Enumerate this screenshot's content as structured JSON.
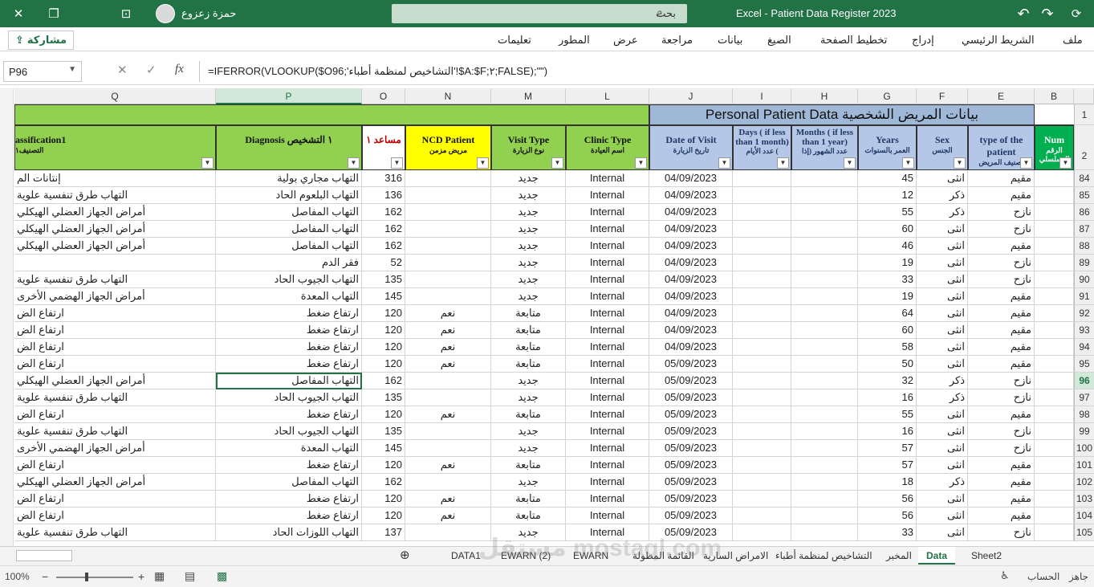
{
  "titlebar": {
    "app_title": "Excel  -  Patient Data Register   2023",
    "search_placeholder": "بحث",
    "user_name": "حمزة زعزوع",
    "close_glyph": "✕",
    "restore_glyph": "❐",
    "ribbon_glyph": "⊡",
    "undo_glyph": "↶",
    "redo_glyph": "↷",
    "save_glyph": "⟳"
  },
  "ribbon": {
    "share_label": "مشاركة",
    "tabs": [
      "ملف",
      "الشريط الرئيسي",
      "إدراج",
      "تخطيط الصفحة",
      "الصيغ",
      "بيانات",
      "مراجعة",
      "عرض",
      "المطور",
      "تعليمات"
    ]
  },
  "formula_bar": {
    "name_box": "P96",
    "formula": "=IFERROR(VLOOKUP($O96;'التشاخيص لمنظمة أطباء'!$A:$F;٢;FALSE);\"\")",
    "cancel": "✕",
    "enter": "✓",
    "fx": "fx"
  },
  "columns": [
    "Q",
    "P",
    "O",
    "N",
    "M",
    "L",
    "J",
    "I",
    "H",
    "G",
    "F",
    "E",
    "B"
  ],
  "group_header": "بيانات المريض الشخصية  Personal Patient Data",
  "headers": {
    "classification": "assification1",
    "classification_ar": "التصنيف١",
    "diagnosis": "Diagnosis ١ التشخيص",
    "assistant": "مساعد ١",
    "ncd": "NCD Patient",
    "ncd_ar": "مريض مزمن",
    "visit_type": "Visit Type",
    "visit_type_ar": "نوع الزيارة",
    "clinic": "Clinic Type",
    "clinic_ar": "اسم العيادة",
    "date": "Date of Visit",
    "date_ar": "تاريخ الزيارة",
    "days": "Days ( if less than 1 month)",
    "days_ar": "عدد الأيام (",
    "months": "Months ( if less than 1 year)",
    "months_ar": "عدد الشهور (إذا",
    "years": "Years",
    "years_ar": "العمر بالسنوات",
    "sex": "Sex",
    "sex_ar": "الجنس",
    "type": "type of the patient",
    "type_ar": "تصنيف المريض",
    "num": "Num",
    "num_ar": "الرقم التسلسلي"
  },
  "rows": [
    {
      "n": "84",
      "q": "إنتانات الم",
      "p": "التهاب مجاري بولية",
      "o": "316",
      "ncd": "",
      "m": "جديد",
      "l": "Internal",
      "j": "04/09/2023",
      "g": "45",
      "f": "انثى",
      "e": "مقيم"
    },
    {
      "n": "85",
      "q": "التهاب طرق تنفسية علوية",
      "p": "التهاب البلعوم الحاد",
      "o": "136",
      "ncd": "",
      "m": "جديد",
      "l": "Internal",
      "j": "04/09/2023",
      "g": "12",
      "f": "ذكر",
      "e": "مقيم"
    },
    {
      "n": "86",
      "q": "أمراض الجهاز العضلي الهيكلي",
      "p": "التهاب المفاصل",
      "o": "162",
      "ncd": "",
      "m": "جديد",
      "l": "Internal",
      "j": "04/09/2023",
      "g": "55",
      "f": "ذكر",
      "e": "نازح"
    },
    {
      "n": "87",
      "q": "أمراض الجهاز العضلي الهيكلي",
      "p": "التهاب المفاصل",
      "o": "162",
      "ncd": "",
      "m": "جديد",
      "l": "Internal",
      "j": "04/09/2023",
      "g": "60",
      "f": "انثى",
      "e": "نازح"
    },
    {
      "n": "88",
      "q": "أمراض الجهاز العضلي الهيكلي",
      "p": "التهاب المفاصل",
      "o": "162",
      "ncd": "",
      "m": "جديد",
      "l": "Internal",
      "j": "04/09/2023",
      "g": "46",
      "f": "انثى",
      "e": "مقيم"
    },
    {
      "n": "89",
      "q": "",
      "p": "فقر الدم",
      "o": "52",
      "ncd": "",
      "m": "جديد",
      "l": "Internal",
      "j": "04/09/2023",
      "g": "19",
      "f": "انثى",
      "e": "نازح"
    },
    {
      "n": "90",
      "q": "التهاب طرق تنفسية علوية",
      "p": "التهاب الجيوب الحاد",
      "o": "135",
      "ncd": "",
      "m": "جديد",
      "l": "Internal",
      "j": "04/09/2023",
      "g": "33",
      "f": "انثى",
      "e": "نازح"
    },
    {
      "n": "91",
      "q": "أمراض الجهاز الهضمي الأخرى",
      "p": "التهاب المعدة",
      "o": "145",
      "ncd": "",
      "m": "جديد",
      "l": "Internal",
      "j": "04/09/2023",
      "g": "19",
      "f": "انثى",
      "e": "مقيم"
    },
    {
      "n": "92",
      "q": "ارتفاع الض",
      "p": "ارتفاع ضغط",
      "o": "120",
      "ncd": "نعم",
      "m": "متابعة",
      "l": "Internal",
      "j": "04/09/2023",
      "g": "64",
      "f": "انثى",
      "e": "مقيم"
    },
    {
      "n": "93",
      "q": "ارتفاع الض",
      "p": "ارتفاع ضغط",
      "o": "120",
      "ncd": "نعم",
      "m": "متابعة",
      "l": "Internal",
      "j": "04/09/2023",
      "g": "60",
      "f": "انثى",
      "e": "مقيم"
    },
    {
      "n": "94",
      "q": "ارتفاع الض",
      "p": "ارتفاع ضغط",
      "o": "120",
      "ncd": "نعم",
      "m": "متابعة",
      "l": "Internal",
      "j": "04/09/2023",
      "g": "58",
      "f": "انثى",
      "e": "مقيم"
    },
    {
      "n": "95",
      "q": "ارتفاع الض",
      "p": "ارتفاع ضغط",
      "o": "120",
      "ncd": "نعم",
      "m": "متابعة",
      "l": "Internal",
      "j": "05/09/2023",
      "g": "50",
      "f": "انثى",
      "e": "مقيم"
    },
    {
      "n": "96",
      "q": "أمراض الجهاز العضلي الهيكلي",
      "p": "التهاب المفاصل",
      "o": "162",
      "ncd": "",
      "m": "جديد",
      "l": "Internal",
      "j": "05/09/2023",
      "g": "32",
      "f": "ذكر",
      "e": "نازح"
    },
    {
      "n": "97",
      "q": "التهاب طرق تنفسية علوية",
      "p": "التهاب الجيوب الحاد",
      "o": "135",
      "ncd": "",
      "m": "جديد",
      "l": "Internal",
      "j": "05/09/2023",
      "g": "16",
      "f": "ذكر",
      "e": "نازح"
    },
    {
      "n": "98",
      "q": "ارتفاع الض",
      "p": "ارتفاع ضغط",
      "o": "120",
      "ncd": "نعم",
      "m": "متابعة",
      "l": "Internal",
      "j": "05/09/2023",
      "g": "55",
      "f": "انثى",
      "e": "مقيم"
    },
    {
      "n": "99",
      "q": "التهاب طرق تنفسية علوية",
      "p": "التهاب الجيوب الحاد",
      "o": "135",
      "ncd": "",
      "m": "جديد",
      "l": "Internal",
      "j": "05/09/2023",
      "g": "16",
      "f": "انثى",
      "e": "نازح"
    },
    {
      "n": "100",
      "q": "أمراض الجهاز الهضمي الأخرى",
      "p": "التهاب المعدة",
      "o": "145",
      "ncd": "",
      "m": "جديد",
      "l": "Internal",
      "j": "05/09/2023",
      "g": "57",
      "f": "انثى",
      "e": "نازح"
    },
    {
      "n": "101",
      "q": "ارتفاع الض",
      "p": "ارتفاع ضغط",
      "o": "120",
      "ncd": "نعم",
      "m": "متابعة",
      "l": "Internal",
      "j": "05/09/2023",
      "g": "57",
      "f": "انثى",
      "e": "مقيم"
    },
    {
      "n": "102",
      "q": "أمراض الجهاز العضلي الهيكلي",
      "p": "التهاب المفاصل",
      "o": "162",
      "ncd": "",
      "m": "جديد",
      "l": "Internal",
      "j": "05/09/2023",
      "g": "18",
      "f": "ذكر",
      "e": "مقيم"
    },
    {
      "n": "103",
      "q": "ارتفاع الض",
      "p": "ارتفاع ضغط",
      "o": "120",
      "ncd": "نعم",
      "m": "متابعة",
      "l": "Internal",
      "j": "05/09/2023",
      "g": "56",
      "f": "انثى",
      "e": "مقيم"
    },
    {
      "n": "104",
      "q": "ارتفاع الض",
      "p": "ارتفاع ضغط",
      "o": "120",
      "ncd": "نعم",
      "m": "متابعة",
      "l": "Internal",
      "j": "05/09/2023",
      "g": "56",
      "f": "انثى",
      "e": "مقيم"
    },
    {
      "n": "105",
      "q": "التهاب طرق تنفسية علوية",
      "p": "التهاب اللوزات الحاد",
      "o": "137",
      "ncd": "",
      "m": "جديد",
      "l": "Internal",
      "j": "05/09/2023",
      "g": "33",
      "f": "انثى",
      "e": "نازح"
    }
  ],
  "selected_row": "96",
  "sheet_tabs": [
    "DATA1",
    "EWARN (2)",
    "EWARN",
    "القائمة المطولة",
    "الامراض السارية",
    "التشاخيص لمنظمة أطباء",
    "المخبر",
    "Data",
    "Sheet2"
  ],
  "active_sheet": "Data",
  "status": {
    "zoom": "100%",
    "ready": "جاهز",
    "accessibility": "الحساب",
    "watermark": "مستقل mostaql.com"
  },
  "colors": {
    "excel_green": "#217346",
    "header_green": "#92d050",
    "header_blue": "#b4c7e7",
    "ncd_yellow": "#ffff00",
    "group_blue": "#9fb8d8"
  }
}
